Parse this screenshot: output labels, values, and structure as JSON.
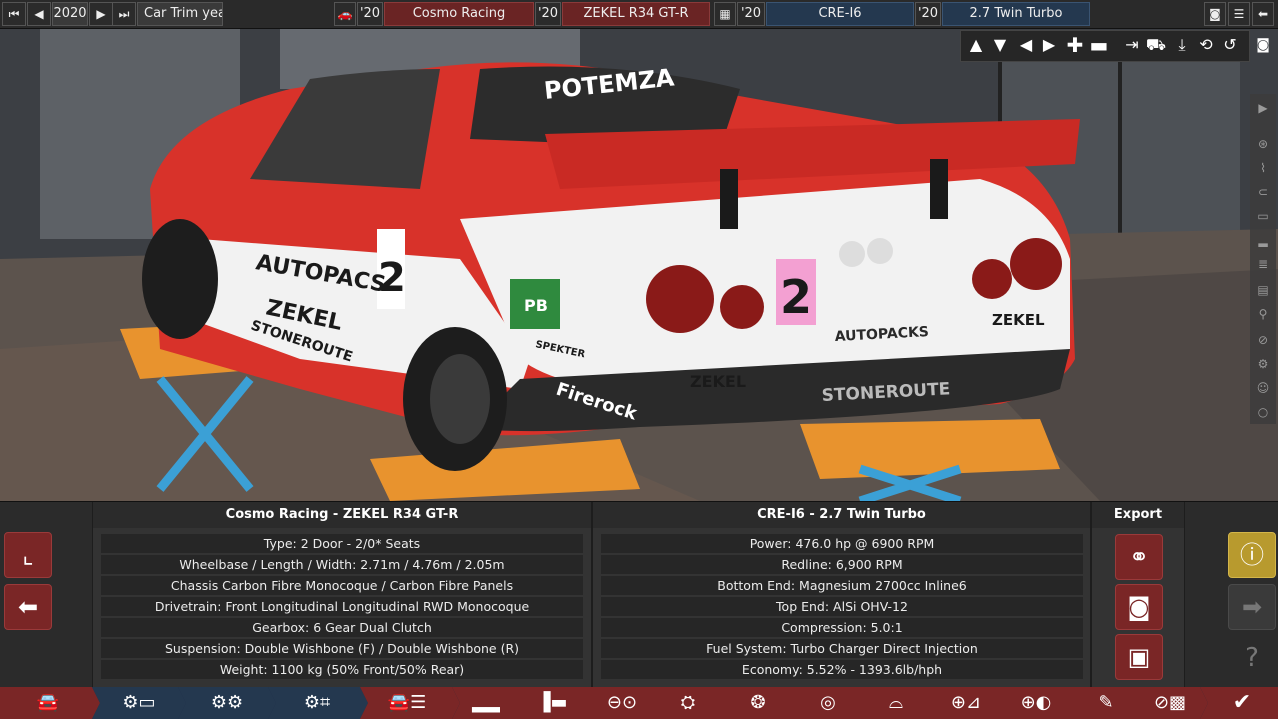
{
  "topbar": {
    "first_icon": "skip-back-icon",
    "prev_icon": "prev-icon",
    "year": "2020",
    "next_icon": "next-icon",
    "last_icon": "skip-forward-icon",
    "sort_label": "Car Trim year",
    "model_icon": "car-icon",
    "model_year": "'20",
    "model_name": "Cosmo Racing",
    "trim_year": "'20",
    "trim_name": "ZEKEL R34 GT-R",
    "engine_icon": "engine-icon",
    "engine_year": "'20",
    "engine_name": "CRE-I6",
    "variant_year": "'20",
    "variant_name": "2.7 Twin Turbo",
    "right_icons": [
      "camera-icon",
      "menu-icon",
      "back-arrow-icon"
    ]
  },
  "camera_tools": [
    "up-arrow-icon",
    "down-arrow-icon",
    "left-arrow-icon",
    "right-arrow-icon",
    "zoom-in-icon",
    "zoom-out-icon",
    "align-icon",
    "car-view-icon",
    "down-align-icon",
    "rotate-icon",
    "reset-icon",
    "screenshot-icon"
  ],
  "side_icons": [
    "expand-icon",
    "wheel-icon",
    "spring-icon",
    "brake-icon",
    "body-icon",
    "car-side-icon",
    "grille-icon",
    "seat-icon",
    "radiator-icon",
    "gear-icon",
    "person-icon",
    "circle-icon"
  ],
  "car_panel": {
    "title": "Cosmo Racing - ZEKEL R34 GT-R",
    "rows": [
      "Type: 2 Door - 2/0* Seats",
      "Wheelbase / Length / Width: 2.71m / 4.76m / 2.05m",
      "Chassis Carbon Fibre Monocoque / Carbon Fibre Panels",
      "Drivetrain: Front Longitudinal Longitudinal RWD Monocoque",
      "Gearbox: 6 Gear Dual Clutch",
      "Suspension: Double Wishbone (F) / Double Wishbone (R)",
      "Weight: 1100 kg (50% Front/50% Rear)"
    ]
  },
  "engine_panel": {
    "title": "CRE-I6 - 2.7 Twin Turbo",
    "rows": [
      "Power: 476.0 hp @ 6900 RPM",
      "Redline:  6,900 RPM",
      "Bottom End: Magnesium 2700cc Inline6",
      "Top End: AlSi OHV-12",
      "Compression: 5.0:1",
      "Fuel System: Turbo Charger Direct Injection",
      "Economy: 5.52% - 1393.6lb/hph"
    ]
  },
  "export": {
    "title": "Export",
    "buttons": [
      "share-icon",
      "camera-icon",
      "save-icon"
    ]
  },
  "left_buttons": [
    "graph-icon",
    "back-arrow-icon"
  ],
  "right_buttons": [
    "warning-icon",
    "forward-arrow-icon",
    "help-icon"
  ],
  "scene": {
    "livery_texts": [
      "POTEMZA",
      "AUTOPACS",
      "ZEKEL",
      "STONEROUTE",
      "PB",
      "SPEKTER",
      "Firerock",
      "AUTOPACKS",
      "ZEKEL",
      "STONEROUTE",
      "ZEKEL",
      "2",
      "2"
    ]
  },
  "navbar": [
    "car-icon",
    "engine-folder-icon",
    "engine-parts-icon",
    "engine-layout-icon",
    "car-design-icon",
    "body-icon",
    "suspension-icon",
    "turbo-icon",
    "gear-icon",
    "wheel-icon",
    "brake-icon",
    "aero-icon",
    "interior-icon",
    "steering-icon",
    "paint-icon",
    "testing-icon",
    "finish-check-icon"
  ],
  "colors": {
    "accent_red": "#7a2626",
    "accent_blue": "#24384f",
    "warning_gold": "#b89a2e",
    "car_red": "#d8322a"
  }
}
